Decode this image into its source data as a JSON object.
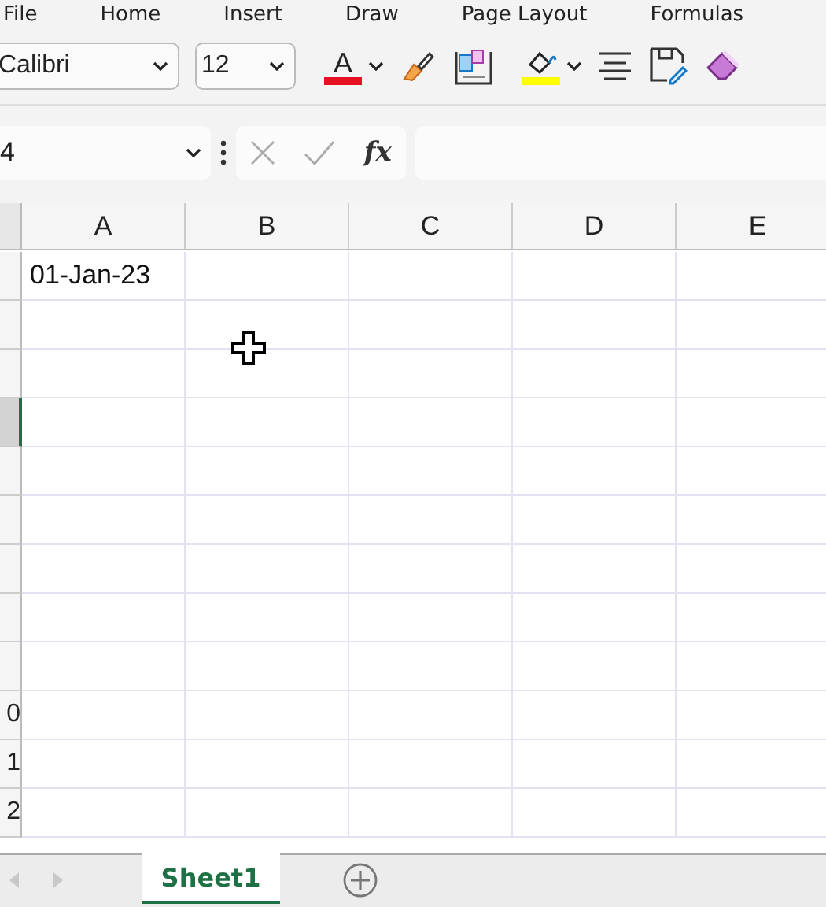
{
  "menu": [
    "File",
    "Home",
    "Insert",
    "Draw",
    "Page Layout",
    "Formulas"
  ],
  "toolbar": {
    "font_name": "Calibri",
    "font_size": "12",
    "font_color": {
      "glyph": "A",
      "color": "#e81123"
    },
    "fill_color": {
      "color": "#ffff00"
    }
  },
  "formula_bar": {
    "name_box": "4",
    "fx_label": "fx"
  },
  "columns": [
    "A",
    "B",
    "C",
    "D",
    "E"
  ],
  "rows": [
    {
      "selected": false,
      "cells": [
        "01-Jan-23"
      ]
    },
    {
      "selected": false
    },
    {
      "selected": false
    },
    {
      "selected": true
    },
    {
      "selected": false
    },
    {
      "selected": false
    },
    {
      "selected": false
    },
    {
      "selected": false
    },
    {
      "selected": false
    },
    {
      "header": "0",
      "selected": false
    },
    {
      "header": "1",
      "selected": false
    },
    {
      "header": "2",
      "selected": false
    }
  ],
  "sheet_tabs": [
    {
      "label": "Sheet1",
      "selected": true
    }
  ]
}
